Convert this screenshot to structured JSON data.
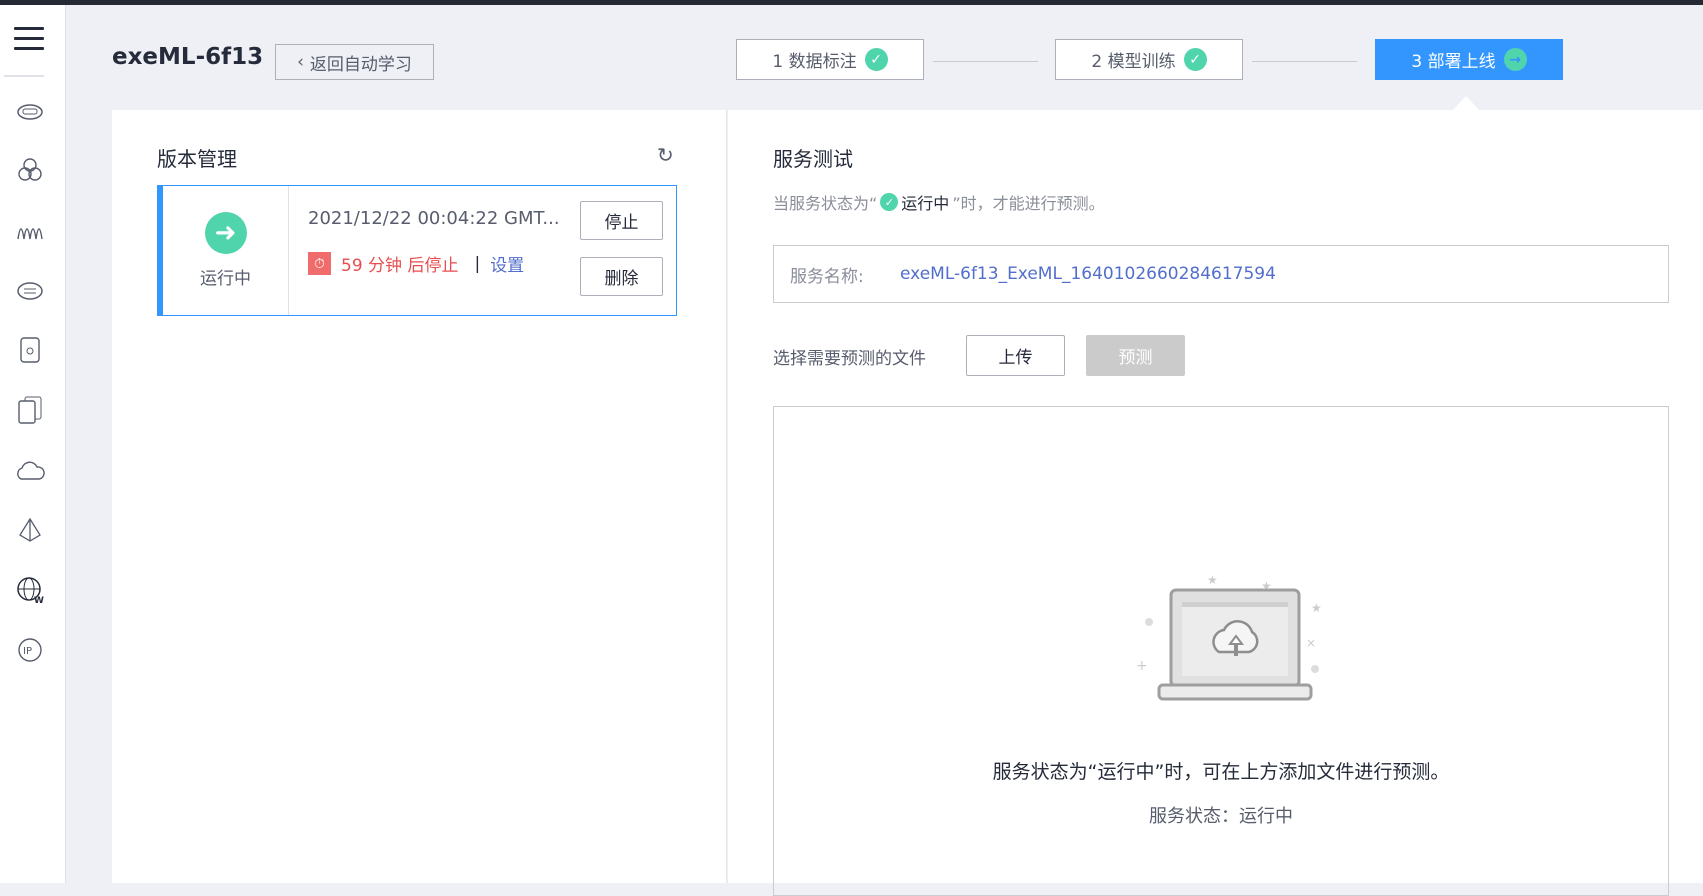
{
  "header": {
    "title": "exeML-6f13",
    "back_label": "返回自动学习"
  },
  "steps": [
    {
      "label": "1 数据标注",
      "status": "done"
    },
    {
      "label": "2 模型训练",
      "status": "done"
    },
    {
      "label": "3 部署上线",
      "status": "active"
    }
  ],
  "sidebar": {
    "icons": [
      "cloud-server-icon",
      "hexagon-cluster-icon",
      "waveform-icon",
      "cloud-storage-icon",
      "device-icon",
      "devices-icon",
      "cloud-edit-icon",
      "network-icon",
      "globe-w-icon",
      "ip-icon"
    ]
  },
  "version_panel": {
    "title": "版本管理",
    "status": "运行中",
    "timestamp": "2021/12/22 00:04:22 GMT...",
    "countdown": "59 分钟 后停止",
    "separator": "|",
    "settings_link": "设置",
    "stop_label": "停止",
    "delete_label": "删除"
  },
  "service_test": {
    "title": "服务测试",
    "hint_prefix": "当服务状态为“",
    "hint_status": "运行中",
    "hint_suffix": "”时，才能进行预测。",
    "name_label": "服务名称:",
    "name_value": "exeML-6f13_ExeML_1640102660284617594",
    "file_label": "选择需要预测的文件",
    "upload_label": "上传",
    "predict_label": "预测",
    "drop_text": "服务状态为“运行中”时，可在上方添加文件进行预测。",
    "drop_status": "服务状态：运行中"
  },
  "colors": {
    "accent": "#3396ff",
    "success": "#50d4ab",
    "danger": "#e84e4e",
    "link": "#526ecc"
  }
}
